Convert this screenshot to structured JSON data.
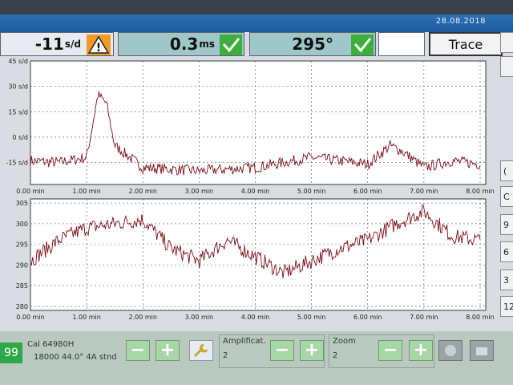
{
  "header": {
    "date": "28.08.2018",
    "rate_value": "-11",
    "rate_unit": "s/d",
    "beat_value": "0.3",
    "beat_unit": "ms",
    "amplitude_value": "295°",
    "trace_label": "Trace"
  },
  "colors": {
    "trace": "#7a0f1a",
    "positive": "#3fae3f",
    "warning": "#f19a2a",
    "panel_teal": "#9fc6c8"
  },
  "icons": [
    "warning-icon",
    "check-icon",
    "check-icon",
    "plus-icon",
    "minus-icon",
    "wrench-icon"
  ],
  "chart_data": [
    {
      "type": "line",
      "ylabel_ticks": [
        "45 s/d",
        "30 s/d",
        "15 s/d",
        "0 s/d",
        "-15 s/d"
      ],
      "ylim": [
        -28,
        45
      ],
      "xlim": [
        0,
        8.1
      ],
      "x_ticks": [
        "0.00 min",
        "1.00 min",
        "2.00 min",
        "3.00 min",
        "4.00 min",
        "5.00 min",
        "6.00 min",
        "7.00 min",
        "8.00 min"
      ],
      "grid": true,
      "series": [
        {
          "x": [
            0,
            0.5,
            1.0,
            1.2,
            1.35,
            1.5,
            2.0,
            3.0,
            4.0,
            4.5,
            5.0,
            6.0,
            6.4,
            6.6,
            7.0,
            7.5,
            8.0
          ],
          "values": [
            -14,
            -15,
            -12,
            25,
            20,
            -5,
            -18,
            -20,
            -18,
            -15,
            -12,
            -16,
            -5,
            -8,
            -18,
            -14,
            -16
          ]
        }
      ]
    },
    {
      "type": "line",
      "ylabel_ticks": [
        "305",
        "300",
        "295",
        "290",
        "285",
        "280"
      ],
      "ylim": [
        279,
        306
      ],
      "xlim": [
        0,
        8.1
      ],
      "x_ticks": [
        "0.00 min",
        "1.00 min",
        "2.00 min",
        "3.00 min",
        "4.00 min",
        "5.00 min",
        "6.00 min",
        "7.00 min",
        "8.00 min"
      ],
      "grid": true,
      "series": [
        {
          "x": [
            0,
            0.5,
            1.0,
            1.5,
            2.0,
            2.5,
            3.0,
            3.5,
            4.0,
            4.5,
            5.0,
            5.5,
            6.0,
            6.5,
            7.0,
            7.5,
            8.0
          ],
          "values": [
            291,
            296,
            299,
            300,
            301,
            294,
            291,
            296,
            292,
            288,
            291,
            294,
            296,
            300,
            303,
            297,
            296
          ]
        }
      ]
    }
  ],
  "side_buttons": [
    "",
    "",
    "(",
    "C",
    "9",
    "6",
    "3",
    "12"
  ],
  "bottom": {
    "count": "99",
    "cal_label": "Cal 64980H",
    "cal_details": "18000  44.0°  4A  stnd",
    "amplification_label": "Amplificat.",
    "amplification_value": "2",
    "zoom_label": "Zoom",
    "zoom_value": "2"
  }
}
